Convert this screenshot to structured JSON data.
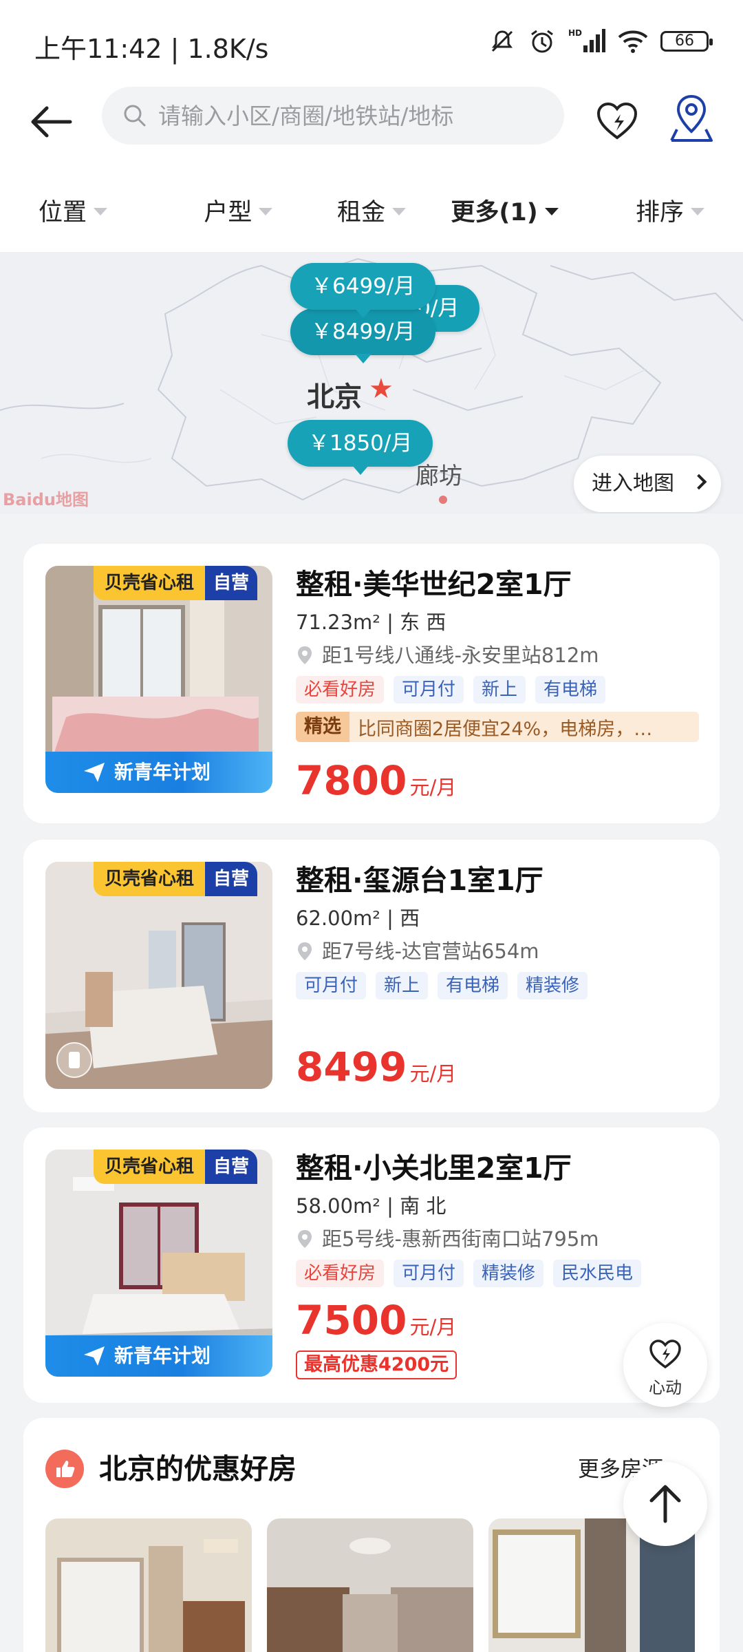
{
  "status_bar": {
    "time": "上午11:42 | 1.8K/s",
    "battery": "66",
    "icons": [
      "mute-icon",
      "alarm-icon",
      "hd-signal-icon",
      "wifi-icon",
      "battery-icon"
    ]
  },
  "header": {
    "search_placeholder": "请输入小区/商圈/地铁站/地标",
    "icons": [
      "back-arrow-icon",
      "search-icon",
      "heart-lightning-icon",
      "map-pin-icon"
    ]
  },
  "filters": [
    {
      "label": "位置",
      "active": false
    },
    {
      "label": "户型",
      "active": false
    },
    {
      "label": "租金",
      "active": false
    },
    {
      "label": "更多(1)",
      "active": true
    },
    {
      "label": "排序",
      "active": false
    }
  ],
  "map": {
    "bubbles": [
      "￥6499/月",
      "￥7800/月",
      "￥8499/月",
      "￥1850/月"
    ],
    "city": "北京",
    "town": "廊坊",
    "logo": "Baidu地图",
    "enter_label": "进入地图"
  },
  "listings": [
    {
      "badge_a": "贝壳省心租",
      "badge_b": "自营",
      "banner": "新青年计划",
      "title": "整租·美华世纪2室1厅",
      "meta": "71.23m² | 东 西",
      "metro": "距1号线八通线-永安里站812m",
      "tags": [
        {
          "text": "必看好房",
          "style": "hot"
        },
        {
          "text": "可月付",
          "style": "normal"
        },
        {
          "text": "新上",
          "style": "normal"
        },
        {
          "text": "有电梯",
          "style": "normal"
        }
      ],
      "pick_label": "精选",
      "pick_text": "比同商圈2居便宜24%，电梯房，…",
      "price": "7800",
      "price_unit": "元/月"
    },
    {
      "badge_a": "贝壳省心租",
      "badge_b": "自营",
      "title": "整租·玺源台1室1厅",
      "meta": "62.00m² | 西",
      "metro": "距7号线-达官营站654m",
      "tags": [
        {
          "text": "可月付",
          "style": "normal"
        },
        {
          "text": "新上",
          "style": "normal"
        },
        {
          "text": "有电梯",
          "style": "normal"
        },
        {
          "text": "精装修",
          "style": "normal"
        }
      ],
      "price": "8499",
      "price_unit": "元/月"
    },
    {
      "badge_a": "贝壳省心租",
      "badge_b": "自营",
      "banner": "新青年计划",
      "title": "整租·小关北里2室1厅",
      "meta": "58.00m² | 南 北",
      "metro": "距5号线-惠新西街南口站795m",
      "tags": [
        {
          "text": "必看好房",
          "style": "hot"
        },
        {
          "text": "可月付",
          "style": "normal"
        },
        {
          "text": "精装修",
          "style": "normal"
        },
        {
          "text": "民水民电",
          "style": "normal"
        }
      ],
      "price": "7500",
      "price_unit": "元/月",
      "discount": "最高优惠4200元"
    }
  ],
  "deals": {
    "title": "北京的优惠好房",
    "more": "更多房源"
  },
  "float_fav_label": "心动",
  "colors": {
    "accent_teal": "#18a2b8",
    "price_red": "#e8342c",
    "badge_yellow": "#fbc531",
    "badge_blue": "#1d3fa8"
  }
}
